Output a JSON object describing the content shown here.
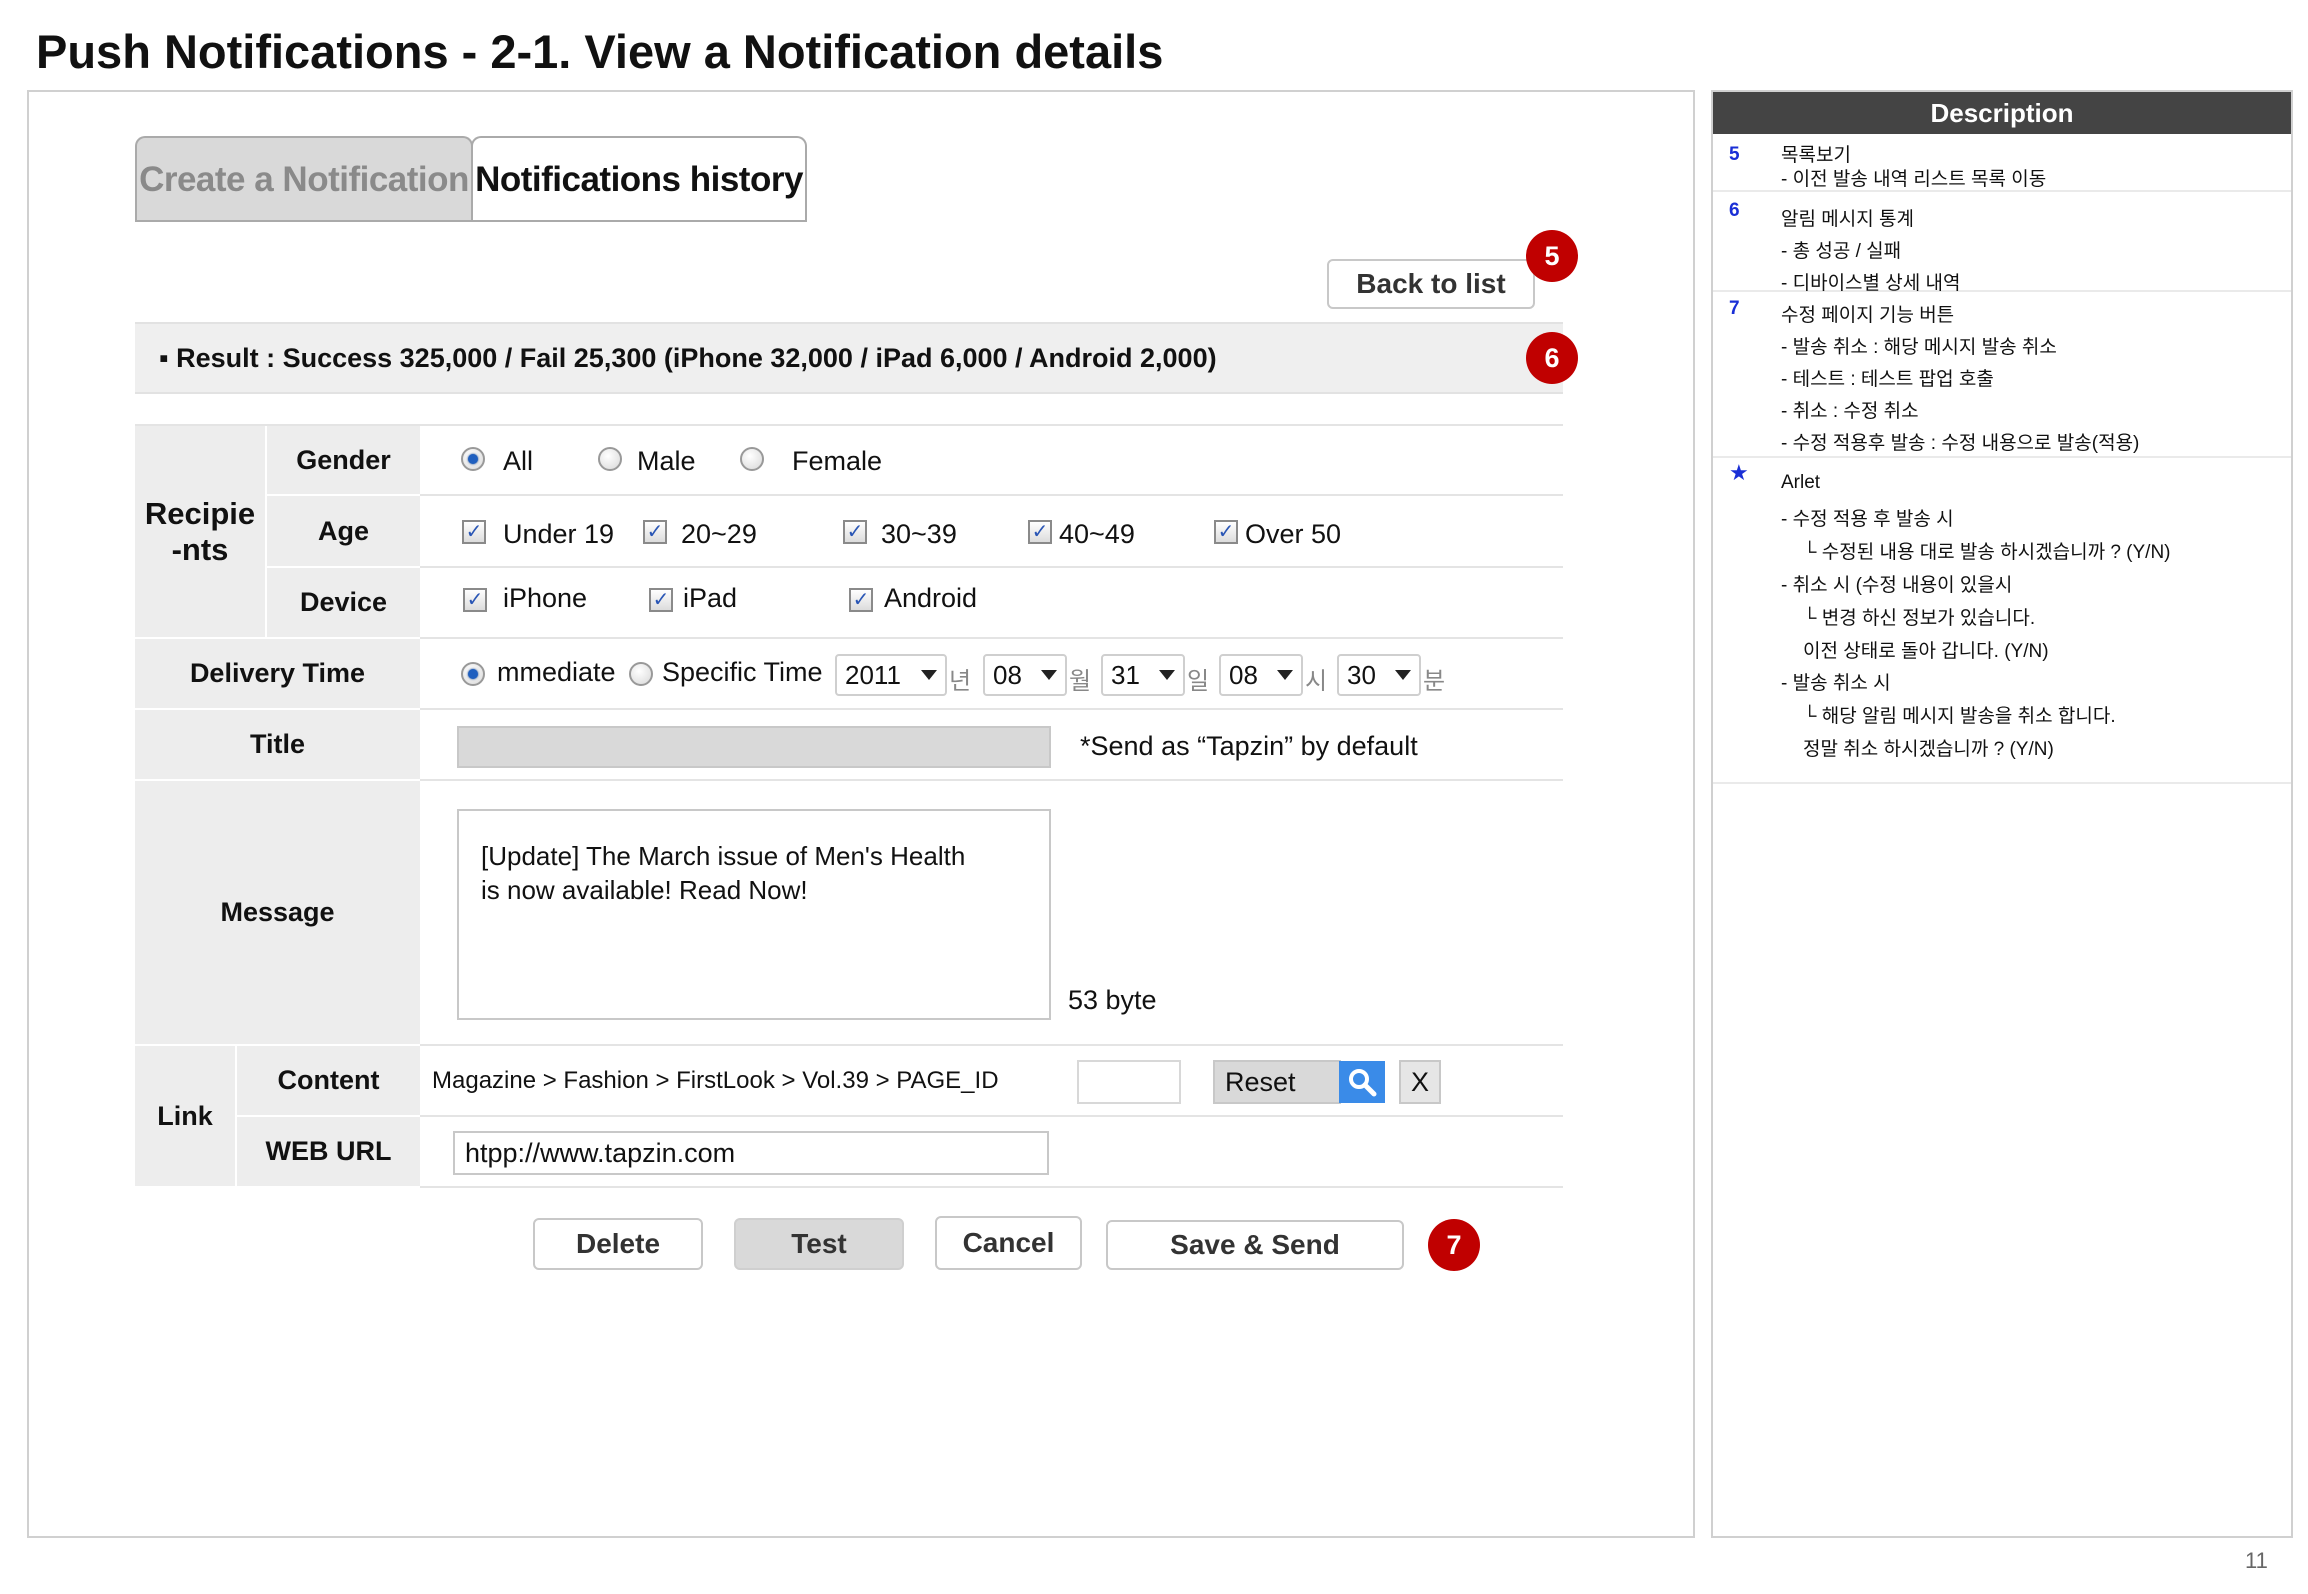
{
  "page_title": "Push Notifications - 2-1. View a Notification details",
  "tabs": {
    "create": "Create a Notification",
    "history": "Notifications history"
  },
  "back_button": "Back to list",
  "badges": {
    "back": "5",
    "result": "6",
    "actions": "7"
  },
  "result_text": "▪ Result : Success 325,000 / Fail 25,300  (iPhone 32,000 / iPad 6,000 / Android 2,000)",
  "recipients": {
    "group_label": "Recipie\n-nts",
    "gender": {
      "label": "Gender",
      "options": [
        "All",
        "Male",
        "Female"
      ],
      "selected": "All"
    },
    "age": {
      "label": "Age",
      "options": [
        "Under 19",
        "20~29",
        "30~39",
        "40~49",
        "Over 50"
      ]
    },
    "device": {
      "label": "Device",
      "options": [
        "iPhone",
        "iPad",
        "Android"
      ]
    }
  },
  "delivery": {
    "label": "Delivery Time",
    "immediate": "mmediate",
    "specific": "Specific Time",
    "year": "2011",
    "year_unit": "년",
    "month": "08",
    "month_unit": "월",
    "day": "31",
    "day_unit": "일",
    "hour": "08",
    "hour_unit": "시",
    "minute": "30",
    "minute_unit": "분"
  },
  "title_row": {
    "label": "Title",
    "note": "*Send as “Tapzin” by default"
  },
  "message": {
    "label": "Message",
    "text": "[Update] The March issue of Men's Health\nis now available! Read Now!",
    "bytes": "53 byte"
  },
  "link": {
    "label": "Link",
    "content_label": "Content",
    "content_path": "Magazine > Fashion > FirstLook > Vol.39  > PAGE_ID",
    "reset": "Reset",
    "close": "X",
    "web_label": "WEB URL",
    "web_value": "htpp://www.tapzin.com"
  },
  "actions": {
    "delete": "Delete",
    "test": "Test",
    "cancel": "Cancel",
    "save_send": "Save & Send"
  },
  "description": {
    "header": "Description",
    "item5": {
      "num": "5",
      "lines": [
        "목록보기",
        "- 이전 발송 내역 리스트 목록 이동"
      ]
    },
    "item6": {
      "num": "6",
      "lines": [
        "알림 메시지 통계",
        "- 총 성공 / 실패",
        "- 디바이스별 상세 내역"
      ]
    },
    "item7": {
      "num": "7",
      "lines": [
        "수정 페이지 기능 버튼",
        "- 발송 취소 : 해당 메시지 발송 취소",
        "- 테스트 : 테스트 팝업 호출",
        "- 취소 : 수정 취소",
        "- 수정 적용후 발송 : 수정 내용으로 발송(적용)"
      ]
    },
    "item_star": {
      "num": "★",
      "lines": [
        "Arlet",
        "- 수정 적용 후 발송 시",
        "  └ 수정된 내용 대로 발송 하시겠습니까 ? (Y/N)",
        "- 취소 시 (수정 내용이 있을시",
        "  └ 변경 하신 정보가 있습니다.",
        "     이전 상태로 돌아 갑니다. (Y/N)",
        "- 발송 취소 시",
        "  └ 해당 알림 메시지 발송을 취소 합니다.",
        "     정말 취소 하시겠습니까 ? (Y/N)"
      ]
    }
  },
  "page_number": "11",
  "colors": {
    "badge": "#c00000",
    "label_bg": "#ededed",
    "desc_header": "#444444",
    "search_blue": "#3a8be8",
    "desc_number": "#1a2fd6"
  }
}
